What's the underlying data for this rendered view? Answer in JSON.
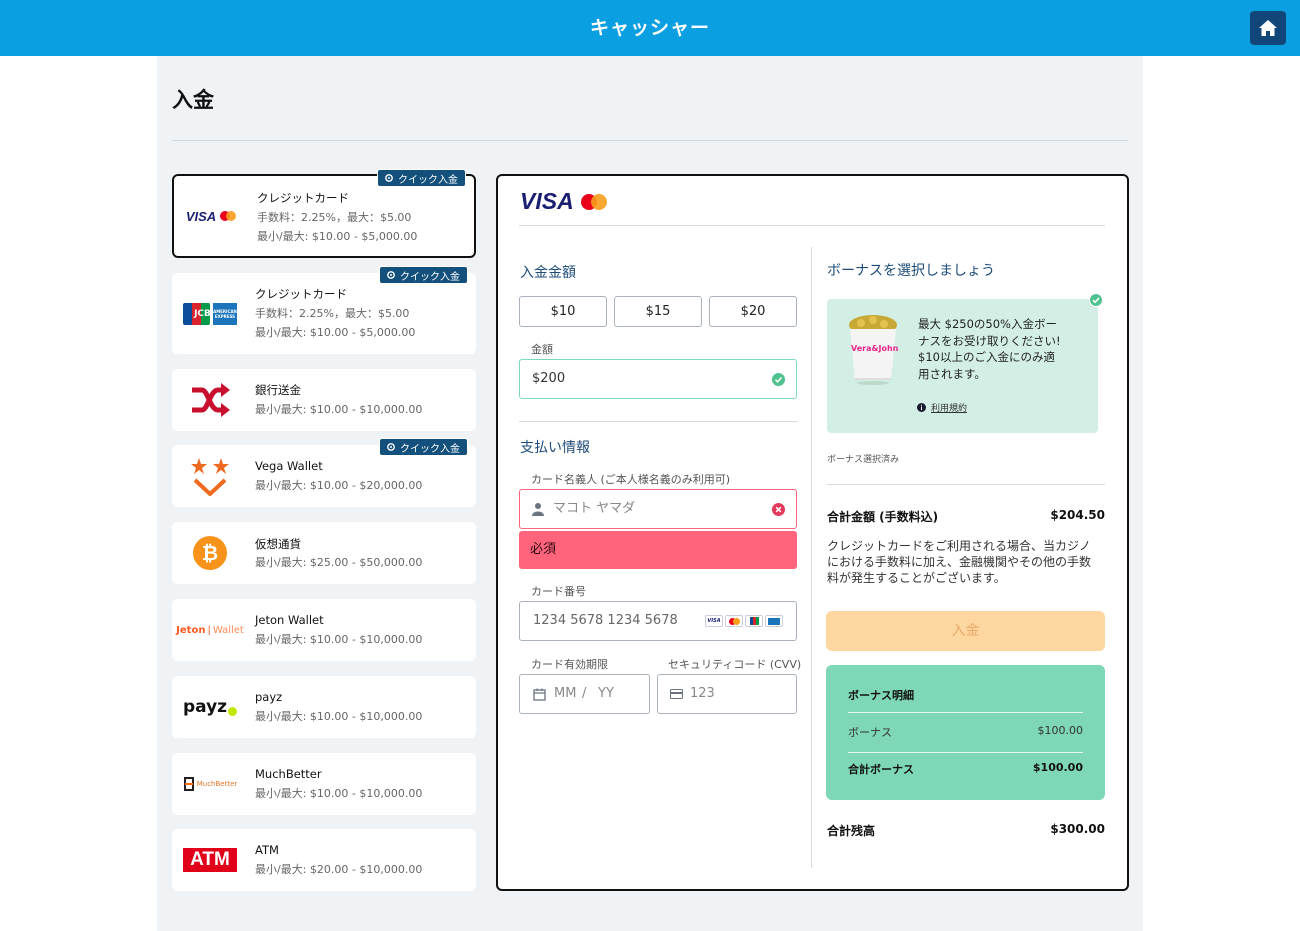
{
  "header": {
    "title": "キャッシャー"
  },
  "page": {
    "title": "入金"
  },
  "methods": [
    {
      "name": "クレジットカード",
      "fee": "手数料：2.25%，最大：$5.00",
      "limits": "最小/最大: $10.00 - $5,000.00",
      "quick": "クイック入金"
    },
    {
      "name": "クレジットカード",
      "fee": "手数料：2.25%，最大：$5.00",
      "limits": "最小/最大: $10.00 - $5,000.00",
      "quick": "クイック入金"
    },
    {
      "name": "銀行送金",
      "limits": "最小/最大: $10.00 - $10,000.00"
    },
    {
      "name": "Vega Wallet",
      "limits": "最小/最大: $10.00 - $20,000.00",
      "quick": "クイック入金"
    },
    {
      "name": "仮想通貨",
      "limits": "最小/最大: $25.00 - $50,000.00"
    },
    {
      "name": "Jeton Wallet",
      "limits": "最小/最大: $10.00 - $10,000.00"
    },
    {
      "name": "payz",
      "limits": "最小/最大: $10.00 - $10,000.00"
    },
    {
      "name": "MuchBetter",
      "limits": "最小/最大: $10.00 - $10,000.00"
    },
    {
      "name": "ATM",
      "limits": "最小/最大: $20.00 - $10,000.00"
    }
  ],
  "logos": {
    "visa": "VISA",
    "jcb": "JCB",
    "amex": "AMERICAN EXPRESS",
    "jeton_a": "Jeton",
    "jeton_b": "Wallet",
    "payz": "payz",
    "muchbetter": "MuchBetter",
    "atm": "ATM"
  },
  "panel": {
    "brand": "VISA",
    "amount_title": "入金金額",
    "presets": [
      "$10",
      "$15",
      "$20"
    ],
    "amount_label": "金額",
    "amount_value": "$200",
    "payment_title": "支払い情報",
    "holder_label": "カード名義人 (ご本人様名義のみ利用可)",
    "holder_placeholder": "マコト ヤマダ",
    "holder_error": "必須",
    "card_label": "カード番号",
    "card_placeholder": "1234 5678 1234 5678",
    "expiry_label": "カード有効期限",
    "expiry_mm": "MM",
    "expiry_sep": "/",
    "expiry_yy": "YY",
    "cvv_label": "セキュリティコード (CVV)",
    "cvv_placeholder": "123"
  },
  "bonus": {
    "title": "ボーナスを選択しましょう",
    "offer_lines": [
      "最大 $250の50%入金ボー",
      "ナスをお受け取りください!",
      "$10以上のご入金にのみ適",
      "用されます。"
    ],
    "terms": "利用規約",
    "selected_note": "ボーナス選択済み",
    "product_text": "Vera&John"
  },
  "summary": {
    "total_label": "合計金額 (手数料込)",
    "total_value": "$204.50",
    "notice_lines": [
      "クレジットカードをご利用される場合、当カジノ",
      "における手数料に加え、金融機関やその他の手数",
      "料が発生することがございます。"
    ],
    "deposit_button": "入金",
    "bonus_detail_title": "ボーナス明細",
    "bonus_label": "ボーナス",
    "bonus_value": "$100.00",
    "bonus_total_label": "合計ボーナス",
    "bonus_total_value": "$100.00",
    "balance_label": "合計残高",
    "balance_value": "$300.00"
  },
  "colors": {
    "header": "#0a9fe0",
    "navy": "#14507c",
    "error": "#ff647c",
    "success": "#7ed8b6",
    "deposit": "#fed7a0"
  }
}
